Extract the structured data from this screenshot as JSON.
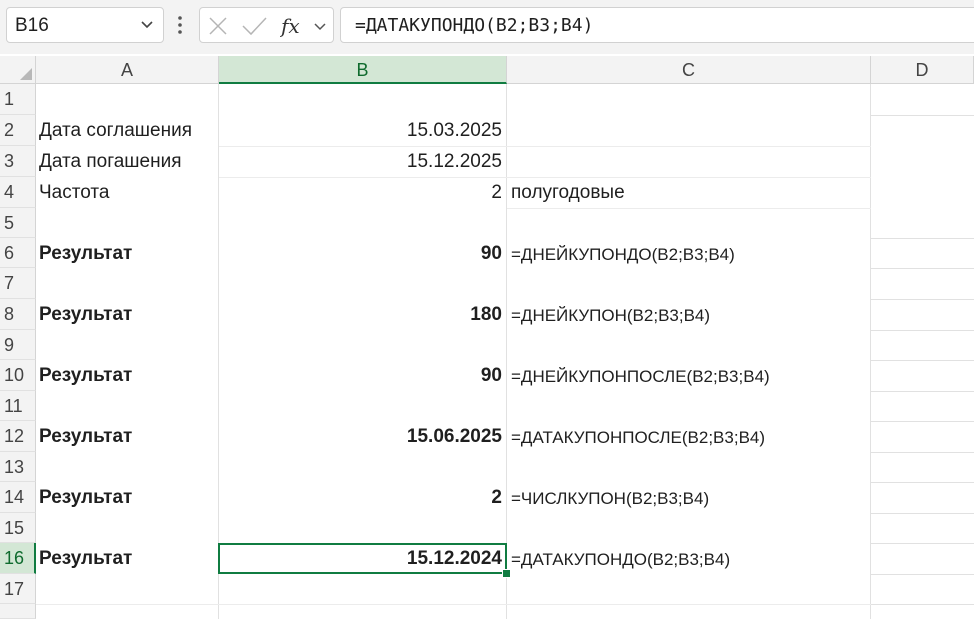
{
  "name_box": {
    "value": "B16"
  },
  "formula_bar": {
    "value": "=ДАТАКУПОНДО(B2;B3;B4)"
  },
  "columns": [
    "A",
    "B",
    "C",
    "D"
  ],
  "rows": [
    "1",
    "2",
    "3",
    "4",
    "5",
    "6",
    "7",
    "8",
    "9",
    "10",
    "11",
    "12",
    "13",
    "14",
    "15",
    "16",
    "17"
  ],
  "selected_cell": "B16",
  "cells": {
    "a2": "Дата соглашения",
    "b2": "15.03.2025",
    "a3": "Дата погашения",
    "b3": "15.12.2025",
    "a4": "Частота",
    "b4": "2",
    "c4": "полугодовые",
    "a6": "Результат",
    "b6": "90",
    "c6": "=ДНЕЙКУПОНДО(B2;B3;B4)",
    "a8": "Результат",
    "b8": "180",
    "c8": "=ДНЕЙКУПОН(B2;B3;B4)",
    "a10": "Результат",
    "b10": "90",
    "c10": "=ДНЕЙКУПОНПОСЛЕ(B2;B3;B4)",
    "a12": "Результат",
    "b12": "15.06.2025",
    "c12": "=ДАТАКУПОНПОСЛЕ(B2;B3;B4)",
    "a14": "Результат",
    "b14": "2",
    "c14": "=ЧИСЛКУПОН(B2;B3;B4)",
    "a16": "Результат",
    "b16": "15.12.2024",
    "c16": "=ДАТАКУПОНДО(B2;B3;B4)"
  },
  "colors": {
    "accent": "#107c41",
    "header_bg": "#f3f3f3",
    "selected_header_bg": "#d3e7d5"
  }
}
